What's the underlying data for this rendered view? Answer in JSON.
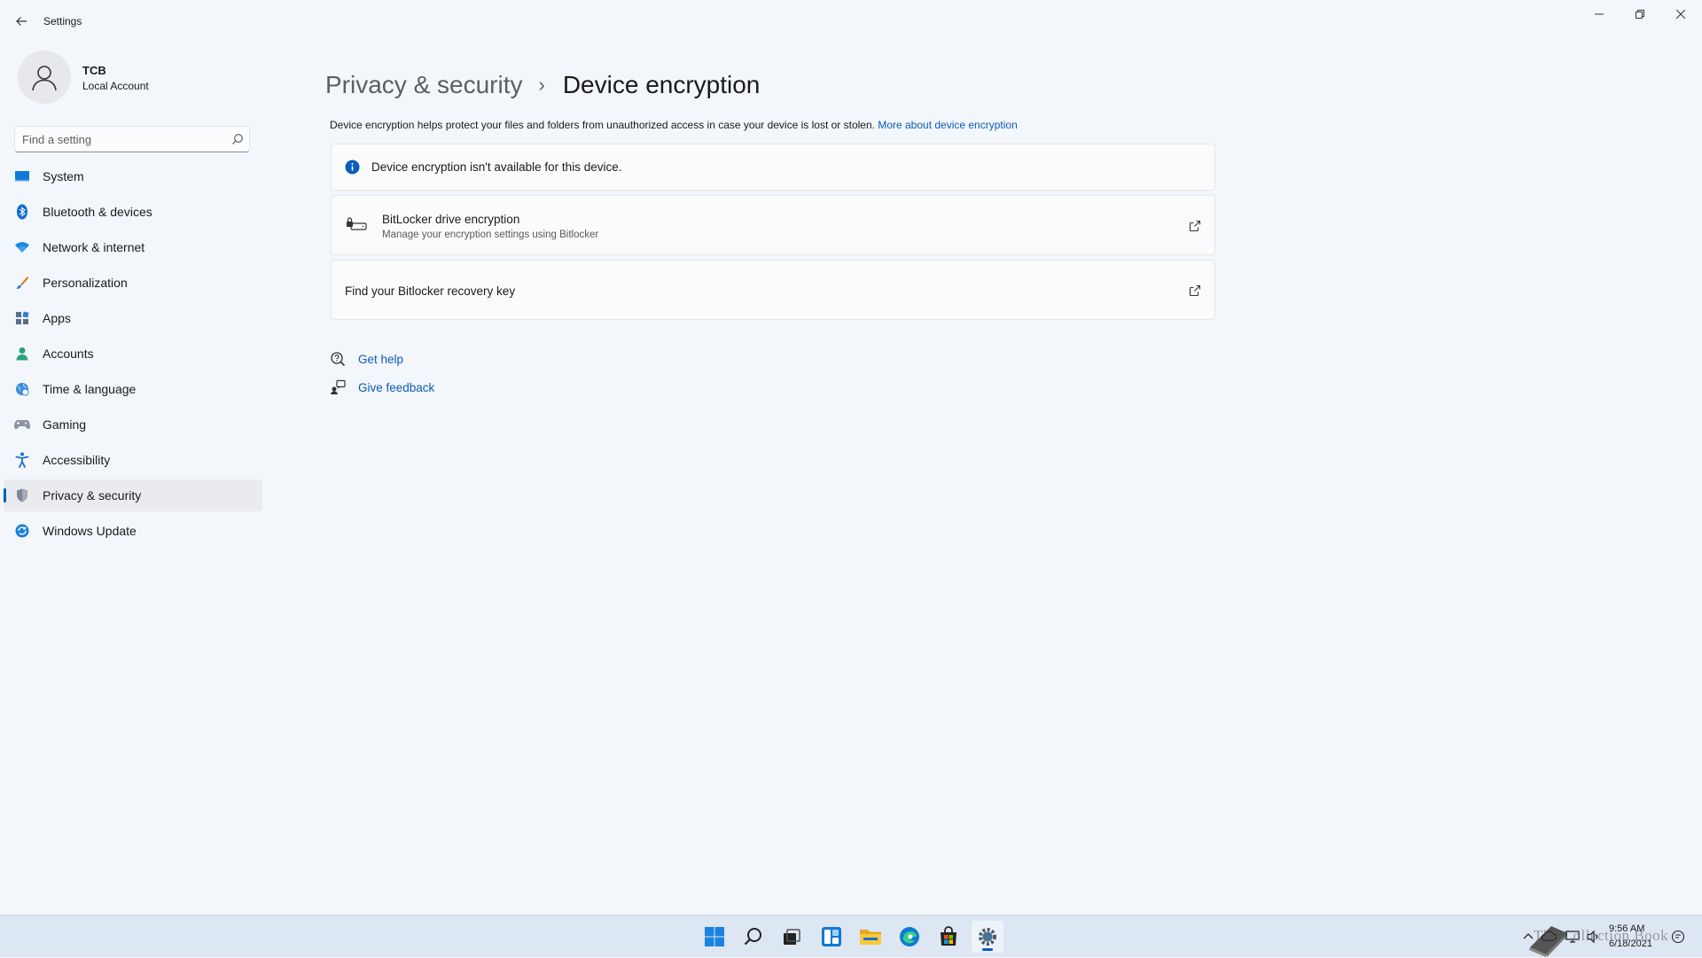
{
  "window": {
    "title": "Settings"
  },
  "profile": {
    "name": "TCB",
    "account_type": "Local Account"
  },
  "search": {
    "placeholder": "Find a setting"
  },
  "nav": {
    "items": [
      {
        "label": "System",
        "icon": "monitor-icon"
      },
      {
        "label": "Bluetooth & devices",
        "icon": "bluetooth-icon"
      },
      {
        "label": "Network & internet",
        "icon": "wifi-icon"
      },
      {
        "label": "Personalization",
        "icon": "brush-icon"
      },
      {
        "label": "Apps",
        "icon": "apps-icon"
      },
      {
        "label": "Accounts",
        "icon": "person-icon"
      },
      {
        "label": "Time & language",
        "icon": "globe-clock-icon"
      },
      {
        "label": "Gaming",
        "icon": "gamepad-icon"
      },
      {
        "label": "Accessibility",
        "icon": "accessibility-icon"
      },
      {
        "label": "Privacy & security",
        "icon": "shield-icon",
        "selected": true
      },
      {
        "label": "Windows Update",
        "icon": "update-icon"
      }
    ]
  },
  "breadcrumb": {
    "parent": "Privacy & security",
    "separator": "›",
    "current": "Device encryption"
  },
  "description": {
    "text": "Device encryption helps protect your files and folders from unauthorized access in case your device is lost or stolen.",
    "link": "More about device encryption"
  },
  "info_card": {
    "text": "Device encryption isn't available for this device."
  },
  "bitlocker_card": {
    "title": "BitLocker drive encryption",
    "subtitle": "Manage your encryption settings using Bitlocker"
  },
  "recovery_card": {
    "title": "Find your Bitlocker recovery key"
  },
  "help_links": {
    "get_help": "Get help",
    "give_feedback": "Give feedback"
  },
  "taskbar": {
    "time": "9:56 AM",
    "date": "6/18/2021",
    "watermark": "The Collection Book"
  },
  "colors": {
    "accent": "#005fb8",
    "link": "#0a5cb8",
    "background": "#f3f6fa",
    "taskbar": "#dde7f3"
  }
}
